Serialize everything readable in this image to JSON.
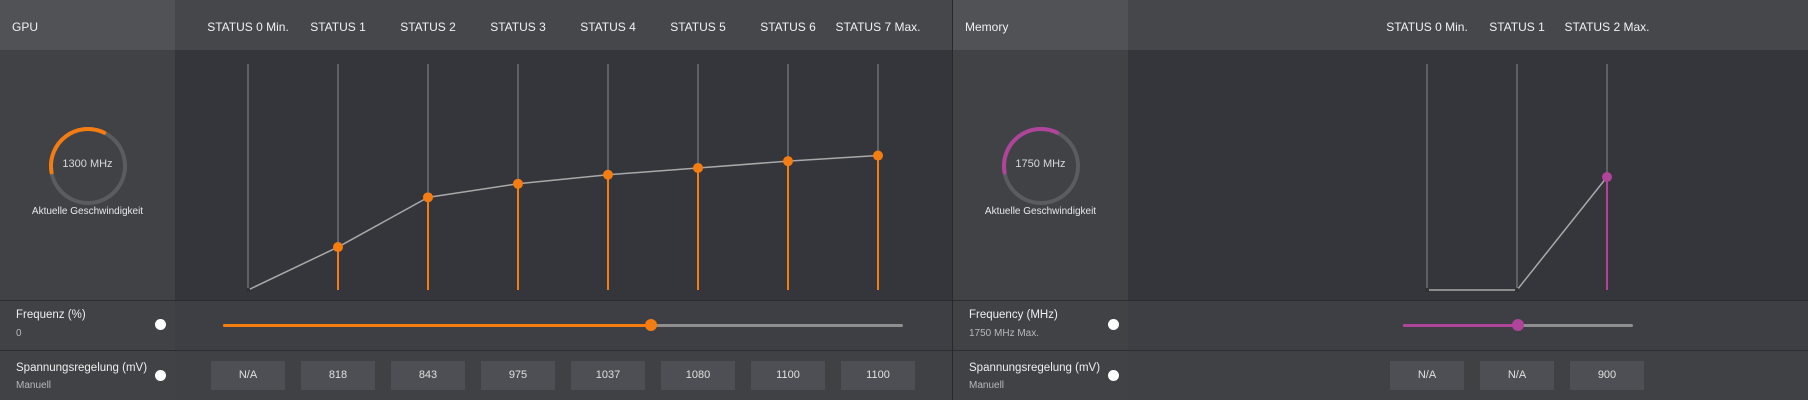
{
  "colors": {
    "gpu_accent": "#f57c10",
    "mem_accent": "#b0449a",
    "line": "#a9a9a9"
  },
  "gpu": {
    "title": "GPU",
    "gauge_value": "1300 MHz",
    "gauge_caption": "Aktuelle Geschwindigkeit",
    "gauge_fraction": 0.35,
    "states": [
      "STATUS 0 Min.",
      "STATUS 1",
      "STATUS 2",
      "STATUS 3",
      "STATUS 4",
      "STATUS 5",
      "STATUS 6",
      "STATUS 7 Max."
    ],
    "frequency": {
      "label": "Frequenz (%)",
      "value": "0",
      "slider_fraction": 0.63
    },
    "voltage": {
      "label": "Spannungsregelung (mV)",
      "mode": "Manuell",
      "values": [
        "N/A",
        "818",
        "843",
        "975",
        "1037",
        "1080",
        "1100",
        "1100"
      ]
    },
    "chart_data": {
      "type": "line",
      "categories": [
        "STATUS 0 Min.",
        "STATUS 1",
        "STATUS 2",
        "STATUS 3",
        "STATUS 4",
        "STATUS 5",
        "STATUS 6",
        "STATUS 7 Max."
      ],
      "values": [
        0,
        19,
        41,
        47,
        51,
        54,
        57,
        59.5
      ],
      "ylim": [
        0,
        100
      ],
      "enabled": [
        false,
        true,
        true,
        true,
        true,
        true,
        true,
        true
      ]
    }
  },
  "memory": {
    "title": "Memory",
    "gauge_value": "1750 MHz",
    "gauge_caption": "Aktuelle Geschwindigkeit",
    "gauge_fraction": 0.35,
    "states": [
      "STATUS 0 Min.",
      "STATUS 1",
      "STATUS 2 Max."
    ],
    "frequency": {
      "label": "Frequency (MHz)",
      "value": "1750 MHz Max.",
      "slider_fraction": 0.5
    },
    "voltage": {
      "label": "Spannungsregelung (mV)",
      "mode": "Manuell",
      "values": [
        "N/A",
        "N/A",
        "900"
      ]
    },
    "chart_data": {
      "type": "line",
      "categories": [
        "STATUS 0 Min.",
        "STATUS 1",
        "STATUS 2 Max."
      ],
      "values": [
        0,
        0,
        50
      ],
      "ylim": [
        0,
        100
      ],
      "enabled": [
        false,
        false,
        true
      ]
    }
  }
}
